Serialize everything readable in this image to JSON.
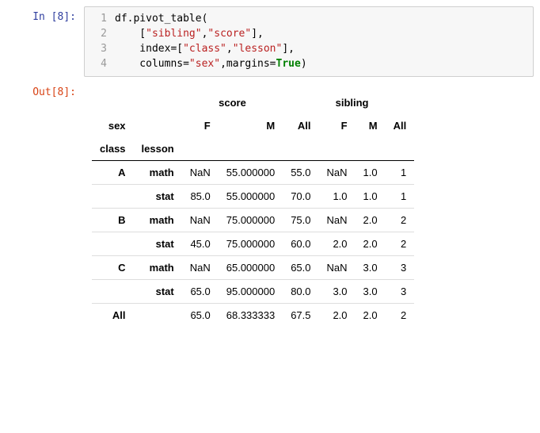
{
  "input": {
    "prompt": "In [8]:",
    "lines": [
      {
        "n": "1",
        "tokens": [
          {
            "cls": "t-plain",
            "t": "df.pivot_table("
          }
        ]
      },
      {
        "n": "2",
        "tokens": [
          {
            "cls": "t-plain",
            "t": "    ["
          },
          {
            "cls": "t-str",
            "t": "\"sibling\""
          },
          {
            "cls": "t-plain",
            "t": ","
          },
          {
            "cls": "t-str",
            "t": "\"score\""
          },
          {
            "cls": "t-plain",
            "t": "],"
          }
        ]
      },
      {
        "n": "3",
        "tokens": [
          {
            "cls": "t-plain",
            "t": "    index=["
          },
          {
            "cls": "t-str",
            "t": "\"class\""
          },
          {
            "cls": "t-plain",
            "t": ","
          },
          {
            "cls": "t-str",
            "t": "\"lesson\""
          },
          {
            "cls": "t-plain",
            "t": "],"
          }
        ]
      },
      {
        "n": "4",
        "tokens": [
          {
            "cls": "t-plain",
            "t": "    columns="
          },
          {
            "cls": "t-str",
            "t": "\"sex\""
          },
          {
            "cls": "t-plain",
            "t": ",margins="
          },
          {
            "cls": "t-kw",
            "t": "True"
          },
          {
            "cls": "t-plain",
            "t": ")"
          }
        ]
      }
    ]
  },
  "output": {
    "prompt": "Out[8]:",
    "top_headers": {
      "score": "score",
      "sibling": "sibling"
    },
    "sex_label": "sex",
    "sub_headers": [
      "F",
      "M",
      "All",
      "F",
      "M",
      "All"
    ],
    "index_names": {
      "class": "class",
      "lesson": "lesson"
    },
    "rows": [
      {
        "class": "A",
        "lesson": "math",
        "cells": [
          "NaN",
          "55.000000",
          "55.0",
          "NaN",
          "1.0",
          "1"
        ]
      },
      {
        "class": "",
        "lesson": "stat",
        "cells": [
          "85.0",
          "55.000000",
          "70.0",
          "1.0",
          "1.0",
          "1"
        ]
      },
      {
        "class": "B",
        "lesson": "math",
        "cells": [
          "NaN",
          "75.000000",
          "75.0",
          "NaN",
          "2.0",
          "2"
        ]
      },
      {
        "class": "",
        "lesson": "stat",
        "cells": [
          "45.0",
          "75.000000",
          "60.0",
          "2.0",
          "2.0",
          "2"
        ]
      },
      {
        "class": "C",
        "lesson": "math",
        "cells": [
          "NaN",
          "65.000000",
          "65.0",
          "NaN",
          "3.0",
          "3"
        ]
      },
      {
        "class": "",
        "lesson": "stat",
        "cells": [
          "65.0",
          "95.000000",
          "80.0",
          "3.0",
          "3.0",
          "3"
        ]
      },
      {
        "class": "All",
        "lesson": "",
        "cells": [
          "65.0",
          "68.333333",
          "67.5",
          "2.0",
          "2.0",
          "2"
        ]
      }
    ]
  }
}
